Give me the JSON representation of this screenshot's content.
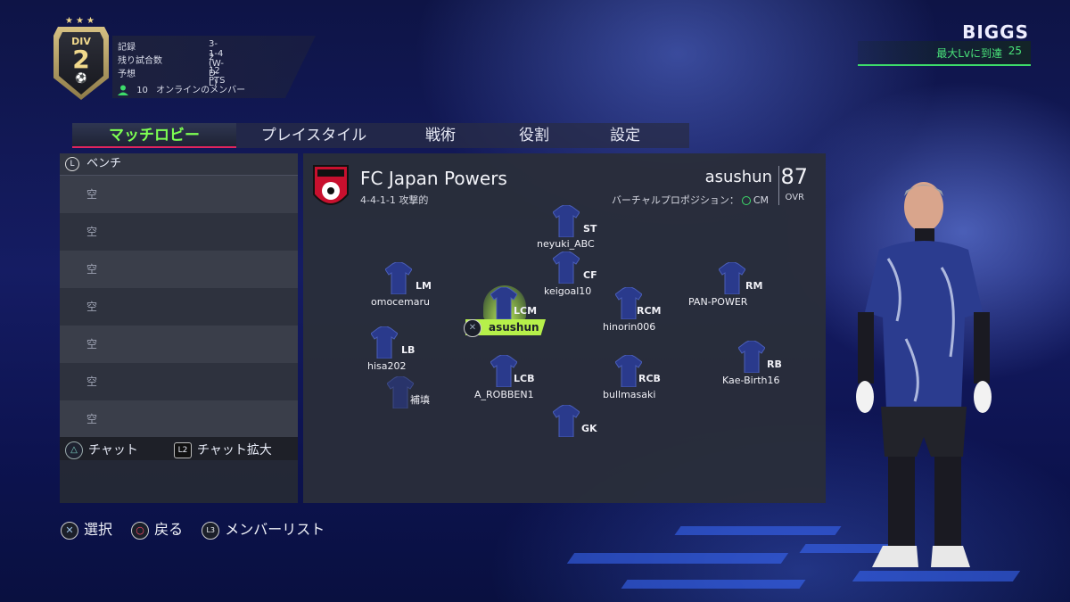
{
  "division": {
    "label": "DIV",
    "number": "2"
  },
  "season_stats": [
    {
      "label": "記録",
      "value": "3-1-4 (W-D-L)"
    },
    {
      "label": "残り試合数",
      "value": "2"
    },
    {
      "label": "予想",
      "value": "12 PTS"
    }
  ],
  "online": {
    "count": "10",
    "label": "オンラインのメンバー"
  },
  "profile": {
    "name": "BIGGS",
    "level_text": "最大Lvに到達",
    "level": "25"
  },
  "tabs": [
    {
      "label": "マッチロビー",
      "active": true
    },
    {
      "label": "プレイスタイル",
      "active": false
    },
    {
      "label": "戦術",
      "active": false
    },
    {
      "label": "役割",
      "active": false
    },
    {
      "label": "設定",
      "active": false
    }
  ],
  "bench": {
    "button": "L",
    "title": "ベンチ",
    "slots": [
      "空",
      "空",
      "空",
      "空",
      "空",
      "空",
      "空"
    ]
  },
  "chat": {
    "chat_btn": "△",
    "chat_label": "チャット",
    "expand_btn": "L2",
    "expand_label": "チャット拡大"
  },
  "club": {
    "name": "FC Japan Powers",
    "formation": "4-4-1-1 攻撃的",
    "user": "asushun",
    "ovr": "87",
    "ovr_label": "OVR",
    "virtual_pro_label": "バーチャルプロポジション：",
    "virtual_pro_pos": "CM"
  },
  "players": [
    {
      "pos": "ST",
      "name": "neyuki_ABC"
    },
    {
      "pos": "CF",
      "name": "keigoal10"
    },
    {
      "pos": "LM",
      "name": "omocemaru"
    },
    {
      "pos": "LCM",
      "name": "asushun"
    },
    {
      "pos": "RCM",
      "name": "hinorin006"
    },
    {
      "pos": "RM",
      "name": "PAN-POWER"
    },
    {
      "pos": "LB",
      "name": "hisa202"
    },
    {
      "pos": "",
      "name": "補填"
    },
    {
      "pos": "LCB",
      "name": "A_ROBBEN1"
    },
    {
      "pos": "RCB",
      "name": "bullmasaki"
    },
    {
      "pos": "RB",
      "name": "Kae-Birth16"
    },
    {
      "pos": "GK",
      "name": ""
    }
  ],
  "me_label": "asushun",
  "bottom": [
    {
      "icon": "✕",
      "label": "選択"
    },
    {
      "icon": "○",
      "label": "戻る"
    },
    {
      "icon": "L3",
      "label": "メンバーリスト"
    }
  ],
  "colors": {
    "accent": "#7dff52",
    "highlight": "#b6f04a",
    "tab_underline": "#e0245e",
    "level_green": "#49e27a"
  }
}
